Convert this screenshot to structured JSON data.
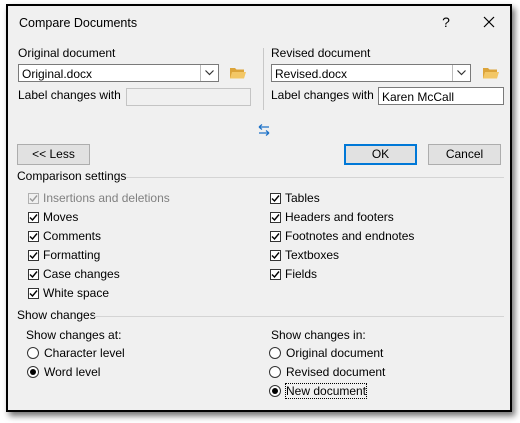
{
  "dialog": {
    "title": "Compare Documents",
    "help_label": "?",
    "close_label": "✕"
  },
  "original": {
    "heading": "Original document",
    "combo_value": "Original.docx",
    "label_changes": "Label changes with",
    "label_value": ""
  },
  "revised": {
    "heading": "Revised document",
    "combo_value": "Revised.docx",
    "label_changes": "Label changes with",
    "label_value": "Karen McCall"
  },
  "buttons": {
    "less": "<< Less",
    "ok": "OK",
    "cancel": "Cancel"
  },
  "comparison": {
    "heading": "Comparison settings",
    "left": [
      {
        "label": "Insertions and deletions",
        "checked": true,
        "disabled": true
      },
      {
        "label": "Moves",
        "checked": true,
        "disabled": false
      },
      {
        "label": "Comments",
        "checked": true,
        "disabled": false
      },
      {
        "label": "Formatting",
        "checked": true,
        "disabled": false
      },
      {
        "label": "Case changes",
        "checked": true,
        "disabled": false
      },
      {
        "label": "White space",
        "checked": true,
        "disabled": false
      }
    ],
    "right": [
      {
        "label": "Tables",
        "checked": true
      },
      {
        "label": "Headers and footers",
        "checked": true
      },
      {
        "label": "Footnotes and endnotes",
        "checked": true
      },
      {
        "label": "Textboxes",
        "checked": true
      },
      {
        "label": "Fields",
        "checked": true
      }
    ]
  },
  "show": {
    "heading": "Show changes",
    "at_label": "Show changes at:",
    "at_options": [
      {
        "label": "Character level",
        "selected": false
      },
      {
        "label": "Word level",
        "selected": true
      }
    ],
    "in_label": "Show changes in:",
    "in_options": [
      {
        "label": "Original document",
        "selected": false
      },
      {
        "label": "Revised document",
        "selected": false
      },
      {
        "label": "New document",
        "selected": true
      }
    ]
  },
  "icons": {
    "folder": "folder-open-icon",
    "swap": "swap-arrows-icon",
    "folder_color": "#e8b54a",
    "swap_color": "#1e72c8",
    "accent": "#0078d7"
  }
}
